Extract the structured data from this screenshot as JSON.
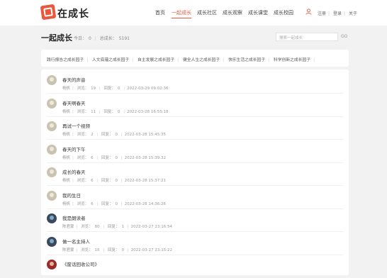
{
  "header": {
    "logo_text": "在成长",
    "nav": [
      "首页",
      "一起成长",
      "成长社区",
      "成长观察",
      "成长课堂",
      "成长校园"
    ],
    "active_nav": "一起成长",
    "user_links": [
      "注册",
      "登录",
      "关于"
    ],
    "accent": "#e9573f"
  },
  "page": {
    "title": "一起成长",
    "today_label": "今日：",
    "today_value": "0",
    "total_label": "总成长：",
    "total_value": "5191",
    "search_placeholder": "搜索一起成长",
    "search_button": "GO"
  },
  "categories": [
    "践行报告之成长园子",
    "人文底蕴之成长园子",
    "自主发展之成长园子",
    "健全人生之成长园子",
    "快乐生活之成长园子",
    "科学创新之成长园子"
  ],
  "list": {
    "views_label": "浏览：",
    "replies_label": "回复：",
    "items": [
      {
        "title": "春天的声音",
        "author": "杨帆",
        "views": "19",
        "replies": "0",
        "time": "2022-03-29 09:02:36",
        "avatar": "default"
      },
      {
        "title": "春天啊春天",
        "author": "杨帆",
        "views": "11",
        "replies": "0",
        "time": "2022-03-28 16:55:18",
        "avatar": "default"
      },
      {
        "title": "再试一个视频",
        "author": "杨帆",
        "views": "2",
        "replies": "0",
        "time": "2022-03-28 15:45:35",
        "avatar": "default"
      },
      {
        "title": "春天的下午",
        "author": "杨帆",
        "views": "6",
        "replies": "0",
        "time": "2022-03-28 15:39:32",
        "avatar": "default"
      },
      {
        "title": "成长的春天",
        "author": "杨帆",
        "views": "6",
        "replies": "0",
        "time": "2022-03-28 15:37:21",
        "avatar": "default"
      },
      {
        "title": "我的生日",
        "author": "杨帆",
        "views": "6",
        "replies": "0",
        "time": "2022-03-28 14:36:26",
        "avatar": "default"
      },
      {
        "title": "我是朗读者",
        "author": "陈君蒙",
        "views": "80",
        "replies": "1",
        "time": "2022-03-27 23:16:54",
        "avatar": "dark"
      },
      {
        "title": "做一名主持人",
        "author": "陈君蒙",
        "views": "16",
        "replies": "0",
        "time": "2022-03-27 23:15:22",
        "avatar": "dark"
      },
      {
        "title": "《废话回收公司》",
        "author": "",
        "views": "",
        "replies": "",
        "time": "",
        "avatar": "red"
      }
    ]
  }
}
